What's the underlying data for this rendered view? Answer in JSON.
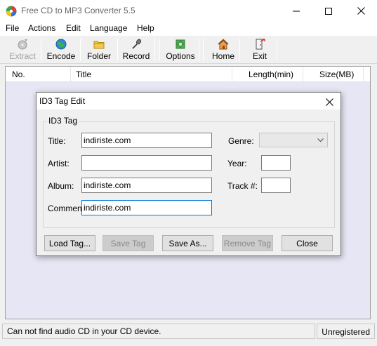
{
  "window": {
    "title": "Free CD to MP3 Converter 5.5",
    "minimize_glyph": "—",
    "maximize_glyph": "☐",
    "close_glyph": "✕"
  },
  "menu": [
    "File",
    "Actions",
    "Edit",
    "Language",
    "Help"
  ],
  "toolbar": {
    "extract": "Extract",
    "encode": "Encode",
    "folder": "Folder",
    "record": "Record",
    "options": "Options",
    "home": "Home",
    "exit": "Exit"
  },
  "list": {
    "columns": [
      "No.",
      "Title",
      "Length(min)",
      "Size(MB)"
    ]
  },
  "status": {
    "message": "Can not find audio CD in your CD device.",
    "registration": "Unregistered"
  },
  "dialog": {
    "title": "ID3 Tag Edit",
    "group": "ID3 Tag",
    "labels": {
      "title": "Title:",
      "artist": "Artist:",
      "album": "Album:",
      "comment": "Comment:",
      "genre": "Genre:",
      "year": "Year:",
      "track": "Track #:"
    },
    "values": {
      "title": "indiriste.com",
      "artist": "",
      "album": "indiriste.com",
      "comment": "indiriste.com",
      "genre": "",
      "year": "",
      "track": ""
    },
    "buttons": {
      "load_tag": "Load Tag...",
      "save_tag": "Save Tag",
      "save_as": "Save As...",
      "remove_tag": "Remove Tag",
      "close": "Close"
    }
  },
  "colors": {
    "list_background": "#e6e6f4",
    "focus_border": "#0078d7"
  }
}
